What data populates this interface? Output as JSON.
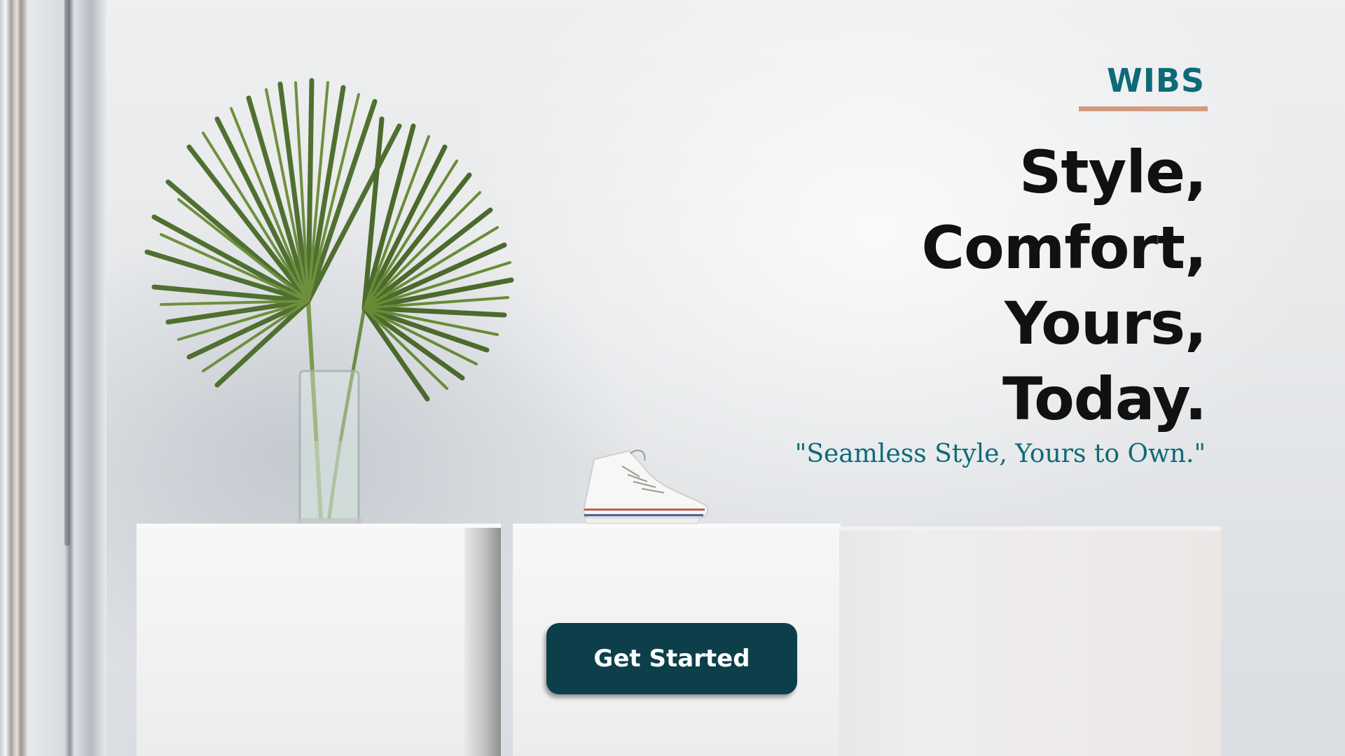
{
  "brand": {
    "name": "WIBS",
    "color": "#0e6a79",
    "underline_color": "#d39a82"
  },
  "hero": {
    "headline_lines": [
      "Style,",
      "Comfort,",
      "Yours,",
      "Today."
    ],
    "tagline": "\"Seamless Style, Yours to Own.\"",
    "cta_label": "Get Started",
    "cta_color": "#0d3f4b"
  },
  "scene": {
    "icons": [
      "palm-plant-icon",
      "sneaker-icon"
    ]
  }
}
